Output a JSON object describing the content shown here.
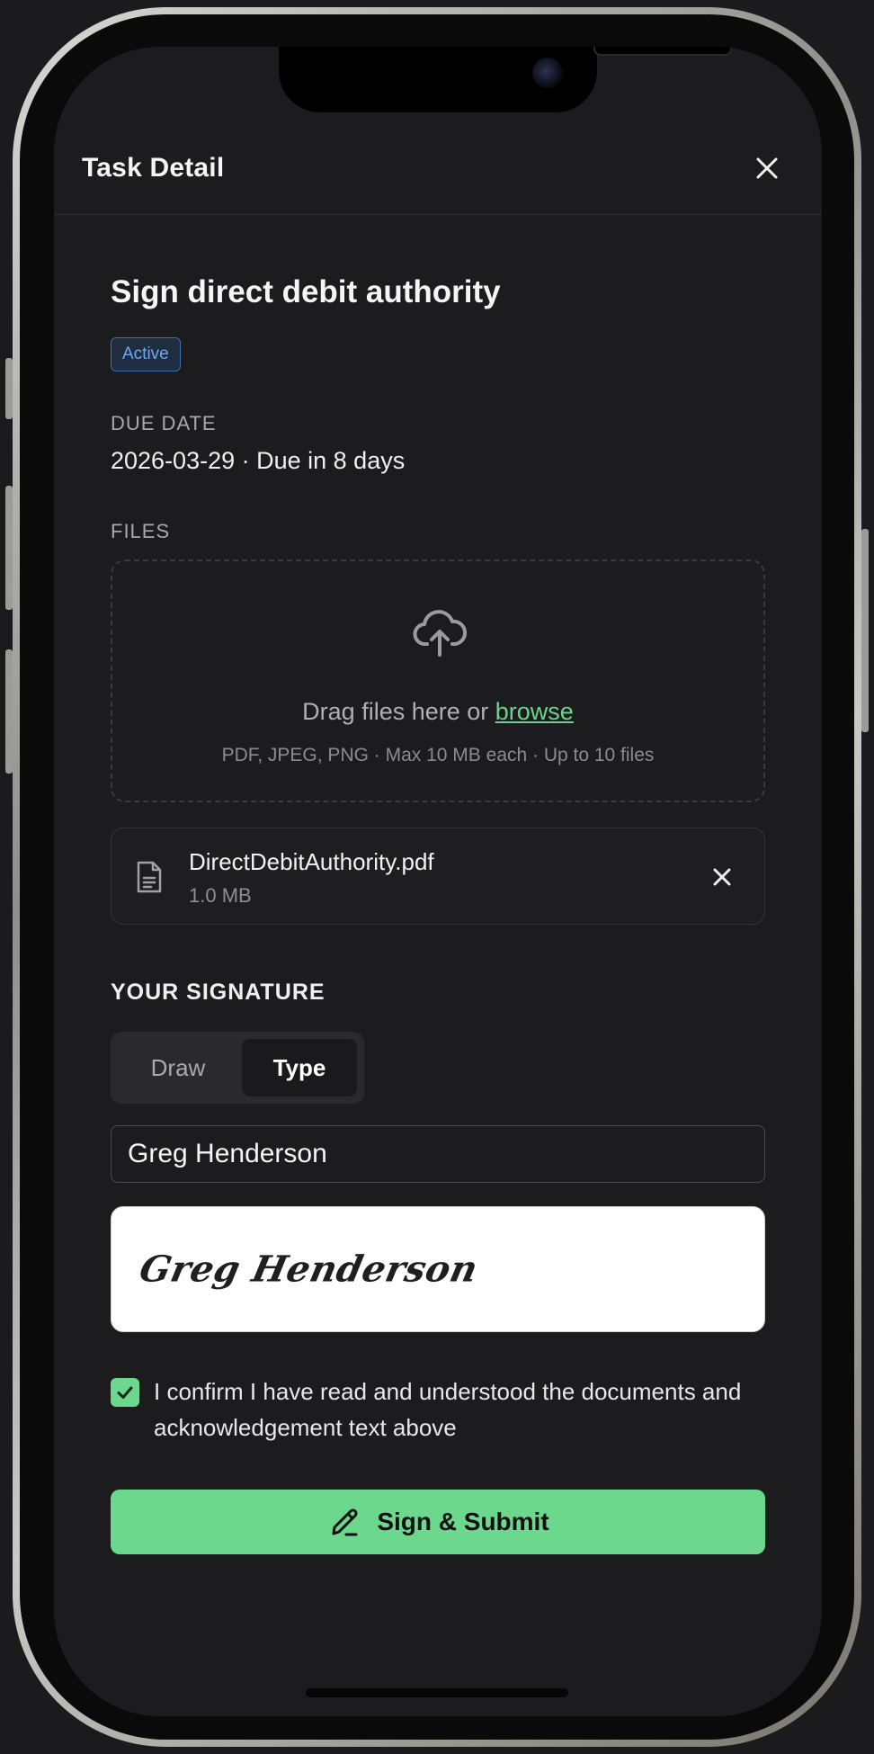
{
  "header": {
    "title": "Task Detail"
  },
  "task": {
    "title": "Sign direct debit authority",
    "status": "Active",
    "due_label": "DUE DATE",
    "due_value": "2026-03-29 · Due in 8 days"
  },
  "files": {
    "label": "FILES",
    "drop_text": "Drag files here or ",
    "drop_link": "browse",
    "drop_hint": "PDF, JPEG, PNG · Max 10 MB each · Up to 10 files",
    "items": [
      {
        "name": "DirectDebitAuthority.pdf",
        "size": "1.0 MB"
      }
    ]
  },
  "signature": {
    "label": "YOUR SIGNATURE",
    "modes": [
      "Draw",
      "Type"
    ],
    "selected_mode": "Type",
    "typed_name": "Greg Henderson",
    "preview": "Greg Henderson"
  },
  "confirm": {
    "checked": true,
    "text": "I confirm I have read and understood the documents and acknowledgement text above"
  },
  "submit": {
    "label": "Sign & Submit"
  },
  "colors": {
    "accent": "#6bd88e",
    "badge_text": "#6ea8f2",
    "background": "#1c1c1e"
  },
  "icons": [
    "close-icon",
    "cloud-upload-icon",
    "document-icon",
    "remove-icon",
    "check-icon",
    "pen-icon"
  ]
}
